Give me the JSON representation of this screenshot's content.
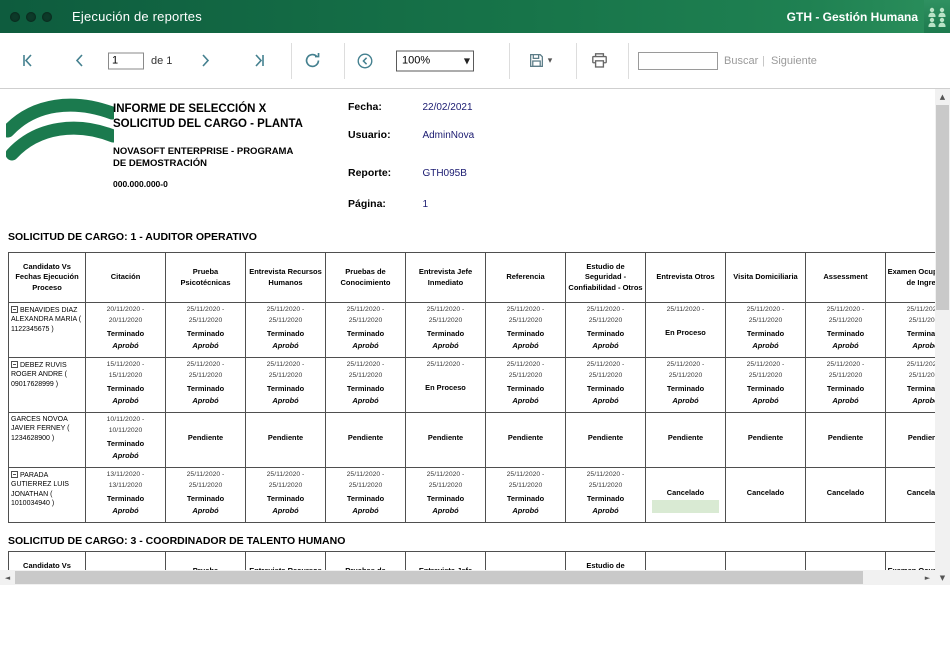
{
  "window": {
    "title": "Ejecución de reportes",
    "app_badge": "GTH - Gestión Humana"
  },
  "toolbar": {
    "page_value": "1",
    "of_label": "de 1",
    "zoom_value": "100%",
    "search_value": "",
    "find_label": "Buscar",
    "find_sep": "|",
    "next_label": "Siguiente"
  },
  "glyphs": {
    "combo_arrow": "▼",
    "save_caret": "▾",
    "h_left": "◄",
    "h_right": "►",
    "v_up": "▲",
    "v_down": "▼"
  },
  "colors": {
    "titlebar_green": "#177449",
    "accent_teal": "#44808f",
    "value_navy": "#1a1a70",
    "highlight_green": "#d9ead3",
    "logo_green": "#1b7a4e"
  },
  "report": {
    "title_line1": "INFORME DE SELECCIÓN X",
    "title_line2": "SOLICITUD DEL CARGO - PLANTA",
    "subtitle_line1": "NOVASOFT ENTERPRISE  - PROGRAMA",
    "subtitle_line2": "DE DEMOSTRACIÓN",
    "company_id": "000.000.000-0",
    "meta": [
      {
        "label": "Fecha:",
        "value": "22/02/2021"
      },
      {
        "label": "Usuario:",
        "value": "AdminNova"
      },
      {
        "label": "Reporte:",
        "value": "GTH095B"
      },
      {
        "label": "Página:",
        "value": "1"
      }
    ]
  },
  "sections": [
    {
      "title": "SOLICITUD DE CARGO: 1 - AUDITOR OPERATIVO"
    },
    {
      "title": "SOLICITUD DE CARGO: 3 - COORDINADOR DE TALENTO HUMANO"
    }
  ],
  "table": {
    "headers": [
      "Candidato Vs Fechas Ejecución Proceso",
      "Citación",
      "Prueba Psicotécnicas",
      "Entrevista Recursos Humanos",
      "Pruebas de Conocimiento",
      "Entrevista Jefe Inmediato",
      "Referencia",
      "Estudio de Seguridad - Confiabilidad - Otros",
      "Entrevista Otros",
      "Visita Domiciliaria",
      "Assessment",
      "Examen Ocupacional de Ingreso"
    ],
    "rows": [
      {
        "candidate": "BENAVIDES DIAZ ALEXANDRA MARIA ( 1122345675 )",
        "toggle": true,
        "cells": [
          {
            "dates": [
              "20/11/2020 -",
              "20/11/2020"
            ],
            "status": "Terminado",
            "result": "Aprobó"
          },
          {
            "dates": [
              "25/11/2020 -",
              "25/11/2020"
            ],
            "status": "Terminado",
            "result": "Aprobó"
          },
          {
            "dates": [
              "25/11/2020 -",
              "25/11/2020"
            ],
            "status": "Terminado",
            "result": "Aprobó"
          },
          {
            "dates": [
              "25/11/2020 -",
              "25/11/2020"
            ],
            "status": "Terminado",
            "result": "Aprobó"
          },
          {
            "dates": [
              "25/11/2020 -",
              "25/11/2020"
            ],
            "status": "Terminado",
            "result": "Aprobó"
          },
          {
            "dates": [
              "25/11/2020 -",
              "25/11/2020"
            ],
            "status": "Terminado",
            "result": "Aprobó"
          },
          {
            "dates": [
              "25/11/2020 -",
              "25/11/2020"
            ],
            "status": "Terminado",
            "result": "Aprobó"
          },
          {
            "dates": [
              "25/11/2020 -"
            ],
            "status": "En Proceso"
          },
          {
            "dates": [
              "25/11/2020 -",
              "25/11/2020"
            ],
            "status": "Terminado",
            "result": "Aprobó"
          },
          {
            "dates": [
              "25/11/2020 -",
              "25/11/2020"
            ],
            "status": "Terminado",
            "result": "Aprobó"
          },
          {
            "dates": [
              "25/11/2020 -",
              "25/11/2020"
            ],
            "status": "Terminado",
            "result": "Aprobó"
          }
        ]
      },
      {
        "candidate": "DEBEZ RUVIS ROGER ANDRE ( 09017628999 )",
        "toggle": true,
        "cells": [
          {
            "dates": [
              "15/11/2020 -",
              "15/11/2020"
            ],
            "status": "Terminado",
            "result": "Aprobó"
          },
          {
            "dates": [
              "25/11/2020 -",
              "25/11/2020"
            ],
            "status": "Terminado",
            "result": "Aprobó"
          },
          {
            "dates": [
              "25/11/2020 -",
              "25/11/2020"
            ],
            "status": "Terminado",
            "result": "Aprobó"
          },
          {
            "dates": [
              "25/11/2020 -",
              "25/11/2020"
            ],
            "status": "Terminado",
            "result": "Aprobó"
          },
          {
            "dates": [
              "25/11/2020 -"
            ],
            "status": "En Proceso"
          },
          {
            "dates": [
              "25/11/2020 -",
              "25/11/2020"
            ],
            "status": "Terminado",
            "result": "Aprobó"
          },
          {
            "dates": [
              "25/11/2020 -",
              "25/11/2020"
            ],
            "status": "Terminado",
            "result": "Aprobó"
          },
          {
            "dates": [
              "25/11/2020 -",
              "25/11/2020"
            ],
            "status": "Terminado",
            "result": "Aprobó"
          },
          {
            "dates": [
              "25/11/2020 -",
              "25/11/2020"
            ],
            "status": "Terminado",
            "result": "Aprobó"
          },
          {
            "dates": [
              "25/11/2020 -",
              "25/11/2020"
            ],
            "status": "Terminado",
            "result": "Aprobó"
          },
          {
            "dates": [
              "25/11/2020 -",
              "25/11/2020"
            ],
            "status": "Terminado",
            "result": "Aprobó"
          }
        ]
      },
      {
        "candidate": "GARCES NOVOA JAVIER FERNEY ( 1234628900 )",
        "toggle": false,
        "cells": [
          {
            "dates": [
              "10/11/2020 -",
              "10/11/2020"
            ],
            "status": "Terminado",
            "result": "Aprobó"
          },
          {
            "status": "Pendiente"
          },
          {
            "status": "Pendiente"
          },
          {
            "status": "Pendiente"
          },
          {
            "status": "Pendiente"
          },
          {
            "status": "Pendiente"
          },
          {
            "status": "Pendiente"
          },
          {
            "status": "Pendiente"
          },
          {
            "status": "Pendiente"
          },
          {
            "status": "Pendiente"
          },
          {
            "status": "Pendiente"
          }
        ]
      },
      {
        "candidate": "PARADA GUTIERREZ LUIS JONATHAN ( 1010034940 )",
        "toggle": true,
        "cells": [
          {
            "dates": [
              "13/11/2020 -",
              "13/11/2020"
            ],
            "status": "Terminado",
            "result": "Aprobó"
          },
          {
            "dates": [
              "25/11/2020 -",
              "25/11/2020"
            ],
            "status": "Terminado",
            "result": "Aprobó"
          },
          {
            "dates": [
              "25/11/2020 -",
              "25/11/2020"
            ],
            "status": "Terminado",
            "result": "Aprobó"
          },
          {
            "dates": [
              "25/11/2020 -",
              "25/11/2020"
            ],
            "status": "Terminado",
            "result": "Aprobó"
          },
          {
            "dates": [
              "25/11/2020 -",
              "25/11/2020"
            ],
            "status": "Terminado",
            "result": "Aprobó"
          },
          {
            "dates": [
              "25/11/2020 -",
              "25/11/2020"
            ],
            "status": "Terminado",
            "result": "Aprobó"
          },
          {
            "dates": [
              "25/11/2020 -",
              "25/11/2020"
            ],
            "status": "Terminado",
            "result": "Aprobó"
          },
          {
            "status": "Cancelado",
            "highlight": true
          },
          {
            "status": "Cancelado"
          },
          {
            "status": "Cancelado"
          },
          {
            "status": "Cancelado"
          }
        ]
      }
    ]
  }
}
